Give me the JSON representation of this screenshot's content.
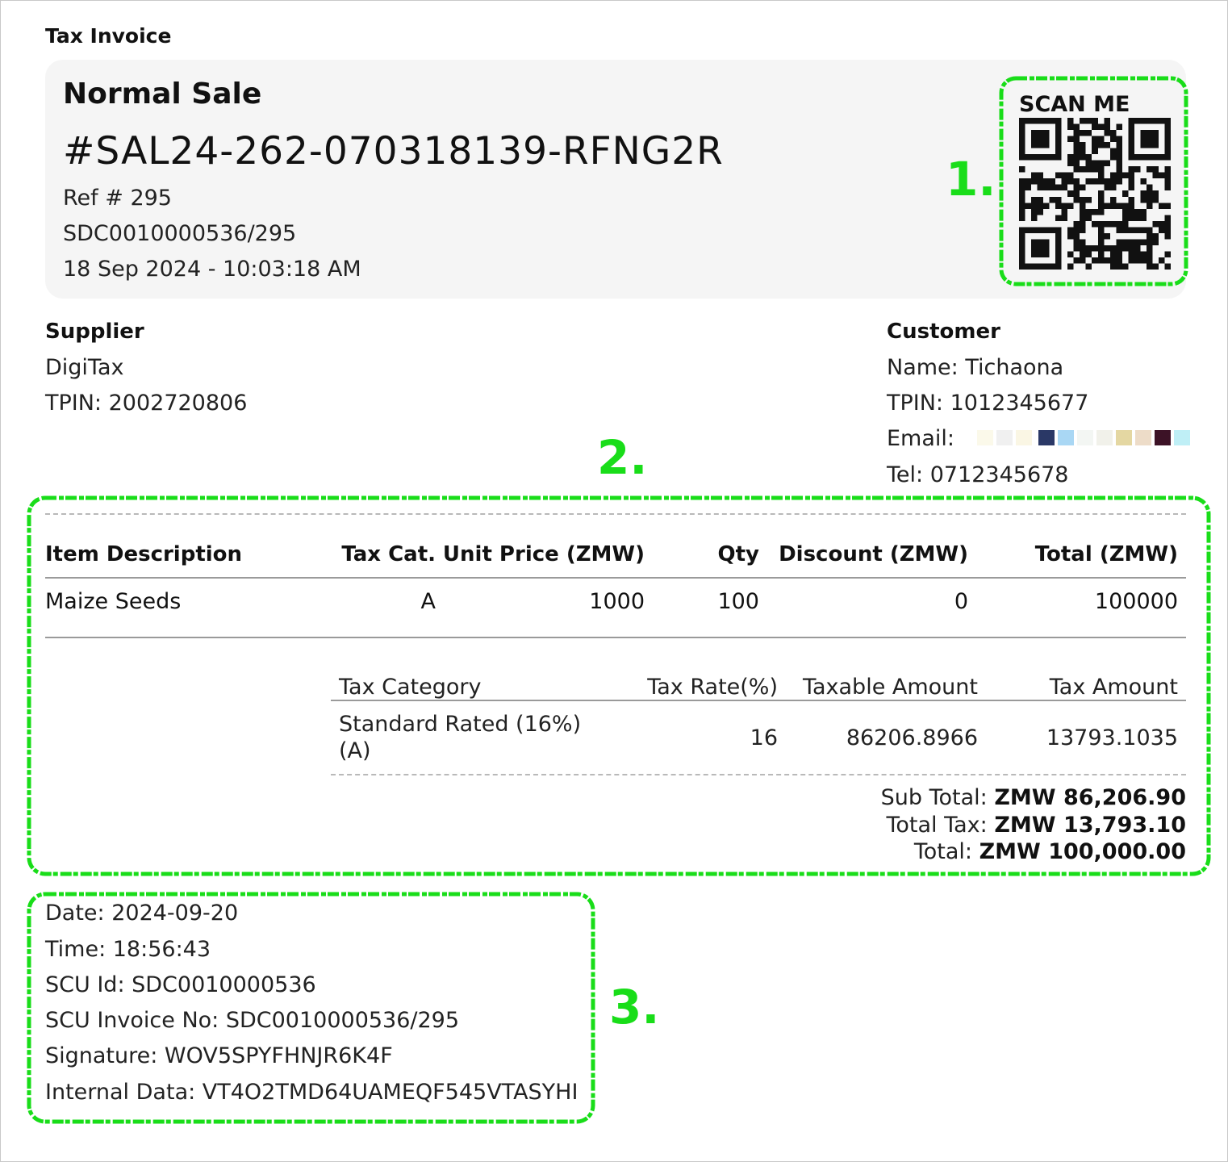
{
  "doc_title": "Tax Invoice",
  "header": {
    "sale_type": "Normal Sale",
    "invoice_number": "#SAL24-262-070318139-RFNG2R",
    "ref": "Ref # 295",
    "sdc_invoice": "SDC0010000536/295",
    "datetime": "18 Sep 2024 - 10:03:18 AM",
    "qr_label": "SCAN ME"
  },
  "annotations": {
    "one": "1.",
    "two": "2.",
    "three": "3."
  },
  "supplier": {
    "heading": "Supplier",
    "name": "DigiTax",
    "tpin": "TPIN: 2002720806"
  },
  "customer": {
    "heading": "Customer",
    "name": "Name: Tichaona",
    "tpin": "TPIN: 1012345677",
    "email_label": "Email:",
    "tel": "Tel: 0712345678"
  },
  "items": {
    "headers": [
      "Item Description",
      "Tax Cat.",
      "Unit Price (ZMW)",
      "Qty",
      "Discount (ZMW)",
      "Total (ZMW)"
    ],
    "rows": [
      [
        "Maize Seeds",
        "A",
        "1000",
        "100",
        "0",
        "100000"
      ]
    ]
  },
  "tax_table": {
    "headers": [
      "Tax Category",
      "Tax Rate(%)",
      "Taxable Amount",
      "Tax Amount"
    ],
    "rows": [
      {
        "category_line1": "Standard Rated (16%)",
        "category_line2": "(A)",
        "rate": "16",
        "taxable": "86206.8966",
        "tax": "13793.1035"
      }
    ]
  },
  "totals": {
    "sub_total_label": "Sub Total:",
    "sub_total_value": "ZMW 86,206.90",
    "total_tax_label": "Total Tax:",
    "total_tax_value": "ZMW 13,793.10",
    "total_label": "Total:",
    "total_value": "ZMW 100,000.00"
  },
  "footer": {
    "date": "Date: 2024-09-20",
    "time": "Time: 18:56:43",
    "scu_id": "SCU Id: SDC0010000536",
    "scu_invoice": "SCU Invoice No: SDC0010000536/295",
    "signature": "Signature: WOV5SPYFHNJR6K4F",
    "internal": "Internal Data: VT4O2TMD64UAMEQF545VTASYHI"
  },
  "colors": {
    "annotation_green": "#19dd19",
    "card_bg": "#f5f5f5",
    "email_redaction": [
      "#fbf9ea",
      "#f0f0f0",
      "#faf6e4",
      "#2a3866",
      "#a9d7f4",
      "#f3f6f3",
      "#f1f1ea",
      "#e4d7a2",
      "#eddcc8",
      "#3c1226",
      "#bfeff6"
    ]
  }
}
